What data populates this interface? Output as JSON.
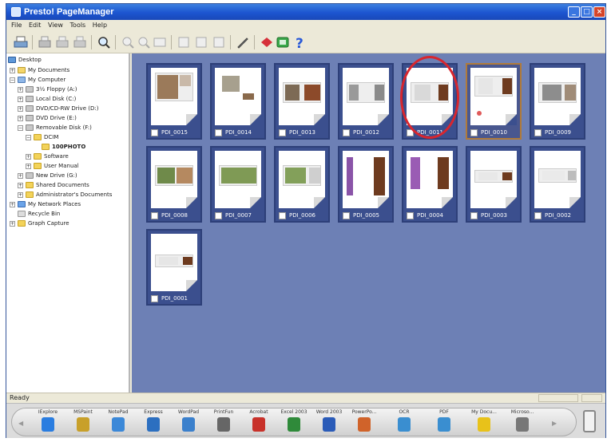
{
  "window": {
    "title": "Presto! PageManager"
  },
  "menu": [
    "File",
    "Edit",
    "View",
    "Tools",
    "Help"
  ],
  "tree": [
    {
      "label": "Desktop",
      "icon": "desktop-icon"
    },
    {
      "label": "My Documents",
      "icon": "folder-icon"
    },
    {
      "label": "My Computer",
      "icon": "computer-icon"
    },
    {
      "label": "3½ Floppy (A:)",
      "icon": "drive-icon"
    },
    {
      "label": "Local Disk (C:)",
      "icon": "drive-icon"
    },
    {
      "label": "DVD/CD-RW Drive (D:)",
      "icon": "drive-icon"
    },
    {
      "label": "DVD Drive (E:)",
      "icon": "drive-icon"
    },
    {
      "label": "Removable Disk (F:)",
      "icon": "drive-icon"
    },
    {
      "label": "DCIM",
      "icon": "folder-icon"
    },
    {
      "label": "100PHOTO",
      "icon": "folder-icon"
    },
    {
      "label": "Software",
      "icon": "folder-icon"
    },
    {
      "label": "User Manual",
      "icon": "folder-icon"
    },
    {
      "label": "New Drive (G:)",
      "icon": "drive-icon"
    },
    {
      "label": "Shared Documents",
      "icon": "folder-icon"
    },
    {
      "label": "Administrator's Documents",
      "icon": "folder-icon"
    },
    {
      "label": "My Network Places",
      "icon": "network-icon"
    },
    {
      "label": "Recycle Bin",
      "icon": "recycle-bin-icon"
    },
    {
      "label": "Graph Capture",
      "icon": "folder-icon"
    }
  ],
  "thumbnails": [
    {
      "label": "PDI_0015"
    },
    {
      "label": "PDI_0014"
    },
    {
      "label": "PDI_0013"
    },
    {
      "label": "PDI_0012"
    },
    {
      "label": "PDI_0011"
    },
    {
      "label": "PDI_0010"
    },
    {
      "label": "PDI_0009"
    },
    {
      "label": "PDI_0008"
    },
    {
      "label": "PDI_0007"
    },
    {
      "label": "PDI_0006"
    },
    {
      "label": "PDI_0005"
    },
    {
      "label": "PDI_0004"
    },
    {
      "label": "PDI_0003"
    },
    {
      "label": "PDI_0002"
    },
    {
      "label": "PDI_0001"
    }
  ],
  "status": {
    "text": "Ready"
  },
  "apps": [
    {
      "label": "IExplore",
      "color": "#2a7de0"
    },
    {
      "label": "MSPaint",
      "color": "#c8a02a"
    },
    {
      "label": "NotePad",
      "color": "#3b88d8"
    },
    {
      "label": "Express",
      "color": "#2c6fc0"
    },
    {
      "label": "WordPad",
      "color": "#3b80cc"
    },
    {
      "label": "PrintFun",
      "color": "#666666"
    },
    {
      "label": "Acrobat",
      "color": "#c8312a"
    },
    {
      "label": "Excel 2003",
      "color": "#2f8a3a"
    },
    {
      "label": "Word 2003",
      "color": "#2a5bb8"
    },
    {
      "label": "PowerPo...",
      "color": "#d0632a"
    },
    {
      "label": "OCR",
      "color": "#3a8ed0"
    },
    {
      "label": "PDF",
      "color": "#3a8ed0"
    },
    {
      "label": "My Docu...",
      "color": "#e8c21a"
    },
    {
      "label": "Microso...",
      "color": "#777777"
    }
  ]
}
